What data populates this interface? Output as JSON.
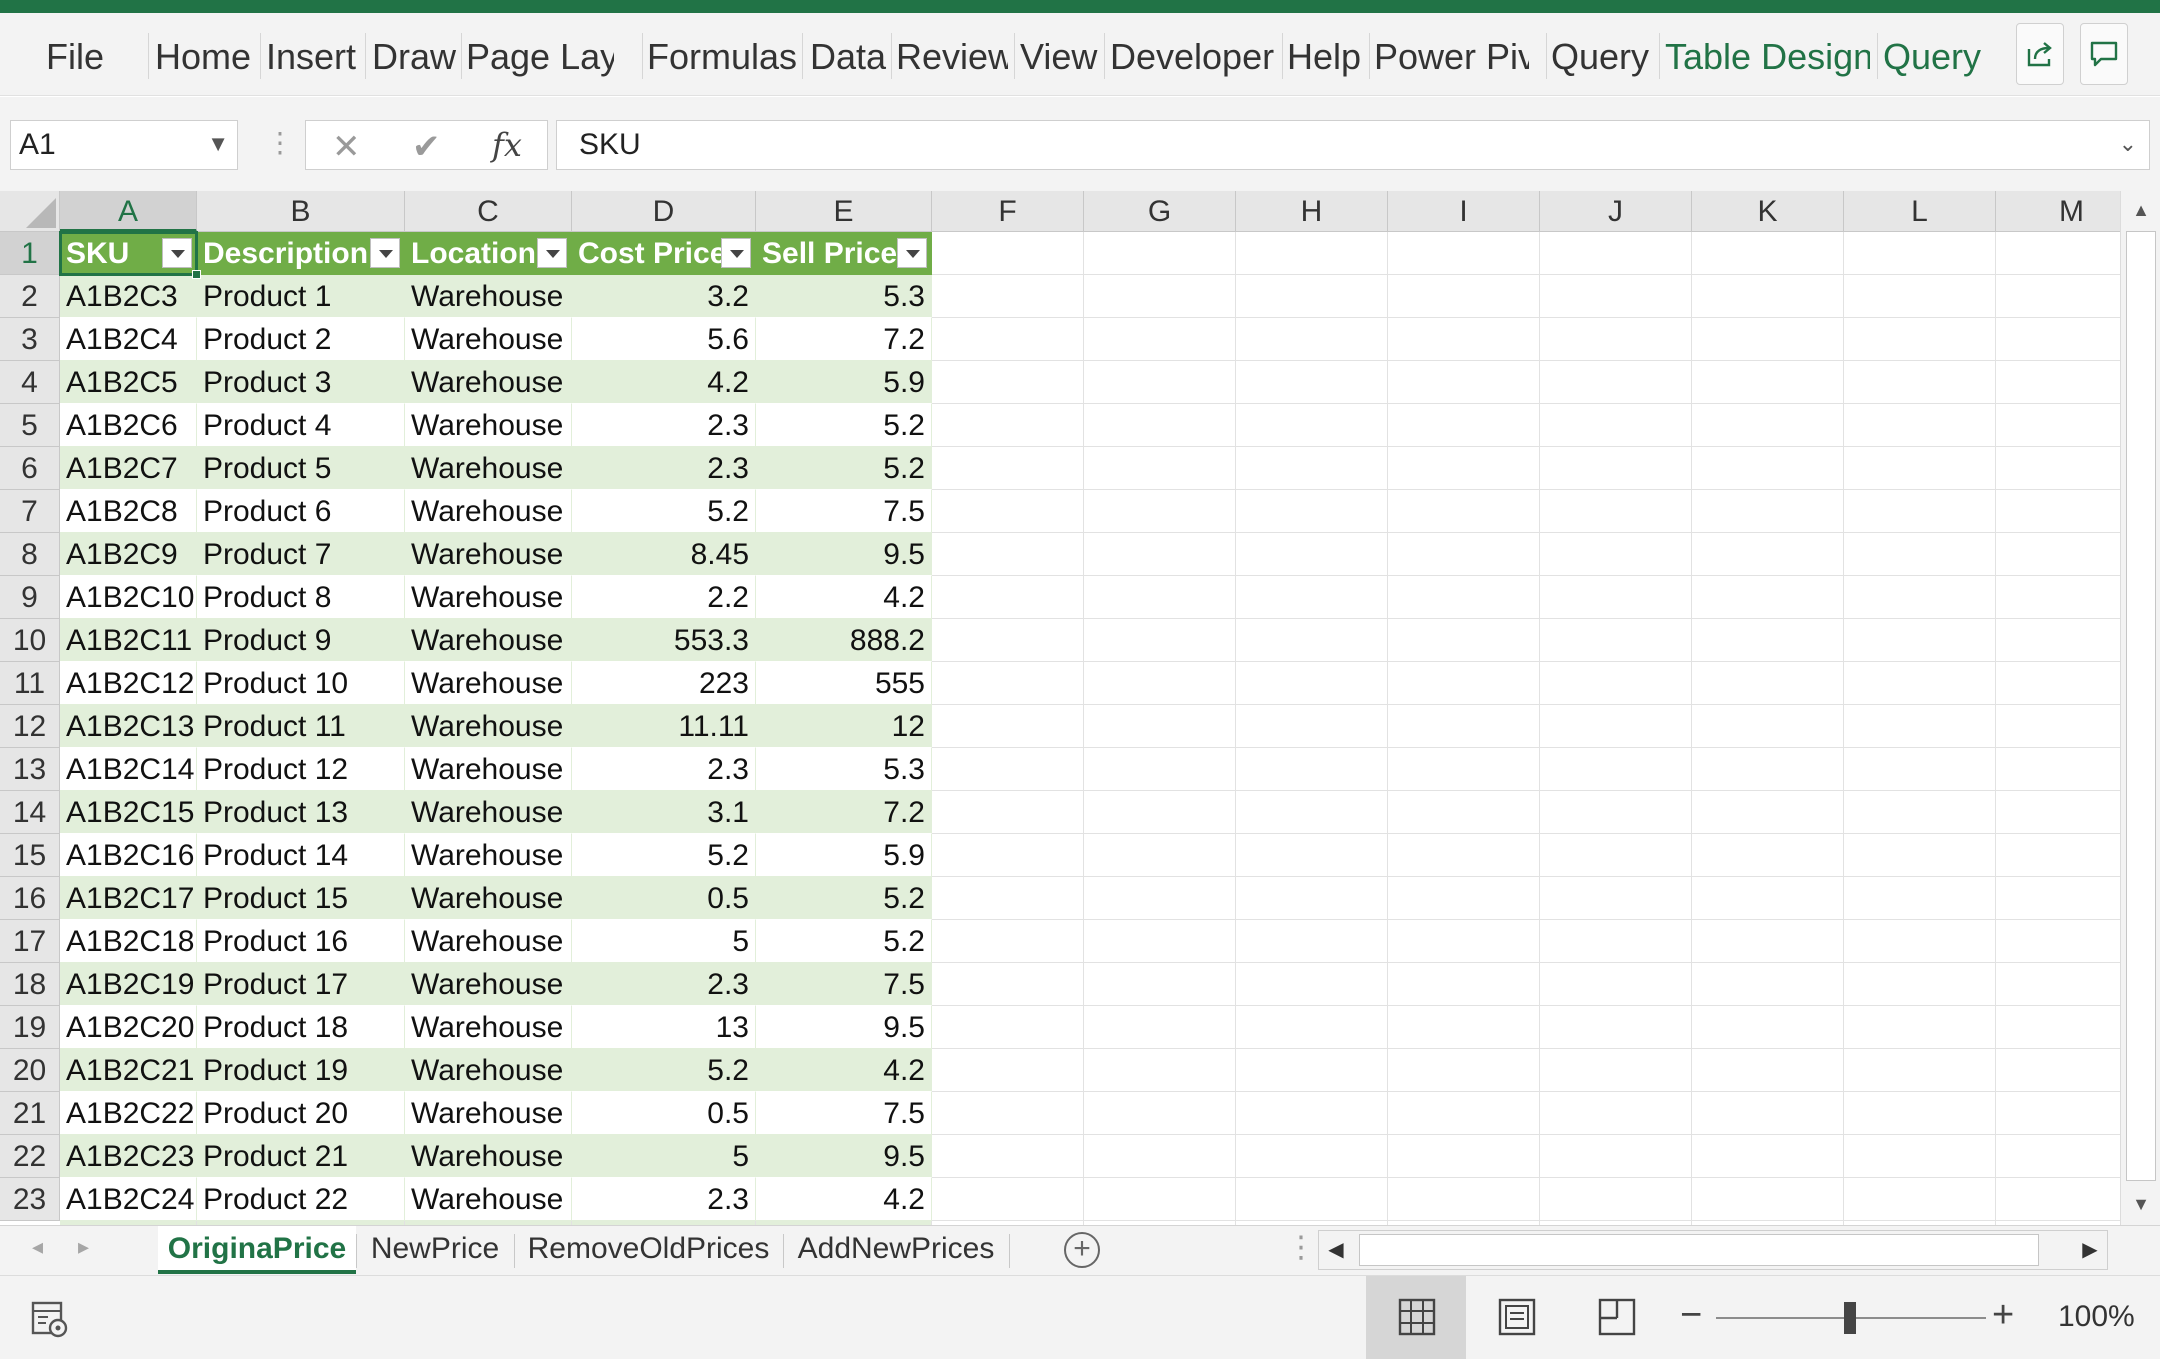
{
  "window": {
    "accent_color": "#217346"
  },
  "ribbon": {
    "tabs": [
      {
        "label": "File",
        "context": false
      },
      {
        "label": "Home",
        "context": false
      },
      {
        "label": "Insert",
        "context": false
      },
      {
        "label": "Draw",
        "context": false
      },
      {
        "label": "Page Layout",
        "context": false
      },
      {
        "label": "Formulas",
        "context": false
      },
      {
        "label": "Data",
        "context": false
      },
      {
        "label": "Review",
        "context": false
      },
      {
        "label": "View",
        "context": false
      },
      {
        "label": "Developer",
        "context": false
      },
      {
        "label": "Help",
        "context": false
      },
      {
        "label": "Power Pivot",
        "context": false
      },
      {
        "label": "Query",
        "context": false
      },
      {
        "label": "Table Design",
        "context": true
      },
      {
        "label": "Query",
        "context": true
      }
    ],
    "share_icon": "share-icon",
    "comments_icon": "comments-icon"
  },
  "formula_bar": {
    "name_box": "A1",
    "formula": "SKU",
    "cancel_symbol": "✕",
    "enter_symbol": "✔",
    "fx_symbol": "fx"
  },
  "grid": {
    "columns": [
      "A",
      "B",
      "C",
      "D",
      "E",
      "F",
      "G",
      "H",
      "I",
      "J",
      "K",
      "L",
      "M"
    ],
    "row_numbers": [
      "1",
      "2",
      "3",
      "4",
      "5",
      "6",
      "7",
      "8",
      "9",
      "10",
      "11",
      "12",
      "13",
      "14",
      "15",
      "16",
      "17",
      "18",
      "19",
      "20",
      "21",
      "22",
      "23"
    ],
    "active_cell": "A1",
    "table": {
      "header_color": "#70ad47",
      "band_color": "#e2efda",
      "headers": [
        "SKU",
        "Description",
        "Location",
        "Cost Price",
        "Sell Price"
      ],
      "rows": [
        [
          "A1B2C3",
          "Product 1",
          "Warehouse",
          "3.2",
          "5.3"
        ],
        [
          "A1B2C4",
          "Product 2",
          "Warehouse",
          "5.6",
          "7.2"
        ],
        [
          "A1B2C5",
          "Product 3",
          "Warehouse",
          "4.2",
          "5.9"
        ],
        [
          "A1B2C6",
          "Product 4",
          "Warehouse",
          "2.3",
          "5.2"
        ],
        [
          "A1B2C7",
          "Product 5",
          "Warehouse",
          "2.3",
          "5.2"
        ],
        [
          "A1B2C8",
          "Product 6",
          "Warehouse",
          "5.2",
          "7.5"
        ],
        [
          "A1B2C9",
          "Product 7",
          "Warehouse",
          "8.45",
          "9.5"
        ],
        [
          "A1B2C10",
          "Product 8",
          "Warehouse",
          "2.2",
          "4.2"
        ],
        [
          "A1B2C11",
          "Product 9",
          "Warehouse",
          "553.3",
          "888.2"
        ],
        [
          "A1B2C12",
          "Product 10",
          "Warehouse",
          "223",
          "555"
        ],
        [
          "A1B2C13",
          "Product 11",
          "Warehouse",
          "11.11",
          "12"
        ],
        [
          "A1B2C14",
          "Product 12",
          "Warehouse",
          "2.3",
          "5.3"
        ],
        [
          "A1B2C15",
          "Product 13",
          "Warehouse",
          "3.1",
          "7.2"
        ],
        [
          "A1B2C16",
          "Product 14",
          "Warehouse",
          "5.2",
          "5.9"
        ],
        [
          "A1B2C17",
          "Product 15",
          "Warehouse",
          "0.5",
          "5.2"
        ],
        [
          "A1B2C18",
          "Product 16",
          "Warehouse",
          "5",
          "5.2"
        ],
        [
          "A1B2C19",
          "Product 17",
          "Warehouse",
          "2.3",
          "7.5"
        ],
        [
          "A1B2C20",
          "Product 18",
          "Warehouse",
          "13",
          "9.5"
        ],
        [
          "A1B2C21",
          "Product 19",
          "Warehouse",
          "5.2",
          "4.2"
        ],
        [
          "A1B2C22",
          "Product 20",
          "Warehouse",
          "0.5",
          "7.5"
        ],
        [
          "A1B2C23",
          "Product 21",
          "Warehouse",
          "5",
          "9.5"
        ],
        [
          "A1B2C24",
          "Product 22",
          "Warehouse",
          "2.3",
          "4.2"
        ]
      ]
    }
  },
  "sheets": {
    "tabs": [
      "OriginaPrice",
      "NewPrice",
      "RemoveOldPrices",
      "AddNewPrices"
    ],
    "active": "OriginaPrice",
    "add_symbol": "+"
  },
  "status_bar": {
    "zoom_label": "100%",
    "zoom_minus": "−",
    "zoom_plus": "+",
    "active_view": "normal"
  }
}
